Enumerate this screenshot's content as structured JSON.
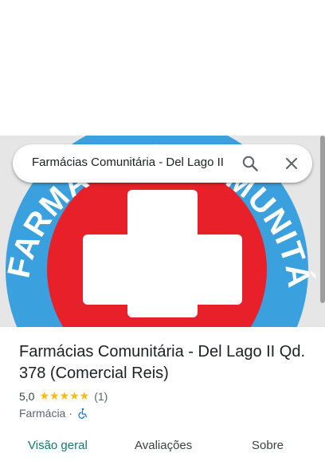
{
  "search": {
    "query": "Farmácias Comunitária - Del Lago II"
  },
  "hero_logo": {
    "arc_text": "FARMÁCIAS COMUNITÁRIA",
    "ring_color": "#3aa0de",
    "inner_color": "#e8202a",
    "cross_color": "#ffffff"
  },
  "place": {
    "title": "Farmácias Comunitária - Del Lago II Qd. 378 (Comercial Reis)",
    "rating": "5,0",
    "stars": "★★★★★",
    "review_count": "(1)",
    "category": "Farmácia",
    "separator": "·"
  },
  "tabs": [
    {
      "label": "Visão geral",
      "active": true
    },
    {
      "label": "Avaliações",
      "active": false
    },
    {
      "label": "Sobre",
      "active": false
    }
  ],
  "colors": {
    "star": "#fbbc04",
    "active_tab": "#16776f",
    "accessibility_icon": "#1a73e8"
  }
}
